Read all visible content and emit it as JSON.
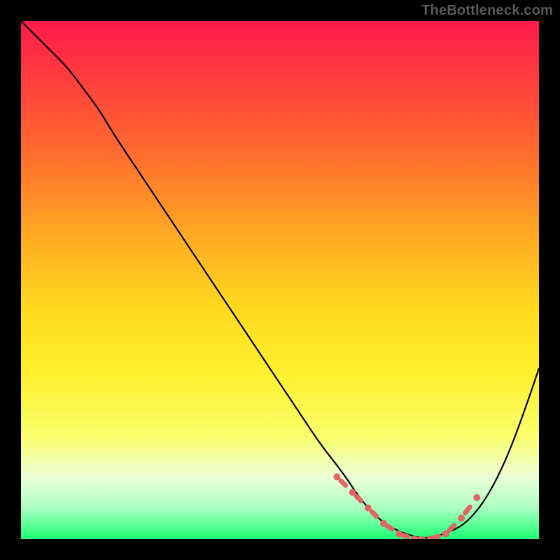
{
  "watermark": "TheBottleneck.com",
  "colors": {
    "background": "#000000",
    "gradient_stops": [
      {
        "offset": 0.0,
        "color": "#ff1a4b"
      },
      {
        "offset": 0.1,
        "color": "#ff3a3f"
      },
      {
        "offset": 0.25,
        "color": "#ff6a2f"
      },
      {
        "offset": 0.4,
        "color": "#ffa423"
      },
      {
        "offset": 0.55,
        "color": "#ffd81e"
      },
      {
        "offset": 0.68,
        "color": "#fff02e"
      },
      {
        "offset": 0.8,
        "color": "#fbff6a"
      },
      {
        "offset": 0.88,
        "color": "#ecffd6"
      },
      {
        "offset": 0.94,
        "color": "#aaffc2"
      },
      {
        "offset": 1.0,
        "color": "#1aff73"
      }
    ],
    "curve": "#000000",
    "marker": "#e06666"
  },
  "chart_data": {
    "type": "line",
    "title": "",
    "xlabel": "",
    "ylabel": "",
    "xlim": [
      0,
      100
    ],
    "ylim": [
      0,
      100
    ],
    "series": [
      {
        "name": "bottleneck-curve",
        "x": [
          0,
          3,
          6,
          9,
          12,
          15,
          18,
          22,
          26,
          30,
          34,
          38,
          42,
          46,
          50,
          54,
          58,
          62,
          66,
          70,
          74,
          78,
          82,
          86,
          90,
          94,
          98,
          100
        ],
        "values": [
          100,
          97,
          94,
          91,
          87,
          83,
          78,
          72,
          66,
          60,
          54,
          48,
          42,
          36,
          30,
          24,
          18,
          13,
          7,
          3,
          1,
          0,
          1,
          3,
          8,
          16,
          27,
          33
        ]
      }
    ],
    "markers": {
      "name": "highlight-band",
      "x": [
        61,
        64,
        67,
        70,
        73,
        76,
        79,
        82,
        85,
        88
      ],
      "values": [
        12,
        9,
        6,
        3,
        1,
        0,
        0,
        1,
        4,
        8
      ]
    }
  }
}
